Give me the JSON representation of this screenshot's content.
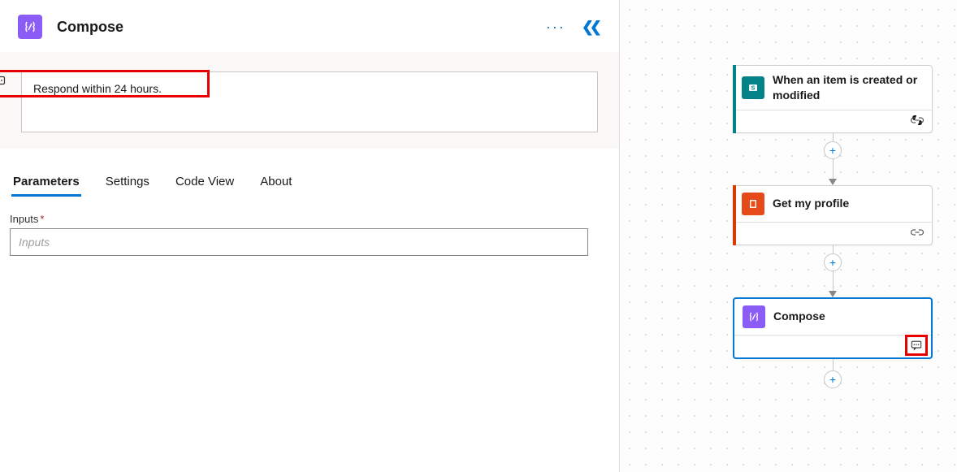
{
  "panel": {
    "title": "Compose",
    "note_text": "Respond within 24 hours.",
    "more_menu": "···"
  },
  "tabs": {
    "items": [
      {
        "label": "Parameters",
        "active": true
      },
      {
        "label": "Settings",
        "active": false
      },
      {
        "label": "Code View",
        "active": false
      },
      {
        "label": "About",
        "active": false
      }
    ]
  },
  "field": {
    "label": "Inputs",
    "required": "*",
    "placeholder": "Inputs",
    "value": ""
  },
  "icons": {
    "compose": "compose-icon",
    "note": "note-icon",
    "collapse": "collapse-panel-icon",
    "link": "link-icon",
    "plus": "+",
    "sharepoint": "S",
    "office": "O"
  },
  "flow": {
    "nodes": [
      {
        "title": "When an item is created or modified",
        "accent": "accent-teal",
        "iconClass": "icon-sp",
        "iconKey": "sharepoint",
        "hasFooter": true,
        "selected": false,
        "footerKind": "link"
      },
      {
        "title": "Get my profile",
        "accent": "accent-red",
        "iconClass": "icon-o365",
        "iconKey": "office",
        "hasFooter": true,
        "selected": false,
        "footerKind": "link"
      },
      {
        "title": "Compose",
        "accent": "accent-purple",
        "iconClass": "icon-compose",
        "iconKey": "compose",
        "hasFooter": true,
        "selected": true,
        "footerKind": "note-highlight"
      }
    ]
  }
}
